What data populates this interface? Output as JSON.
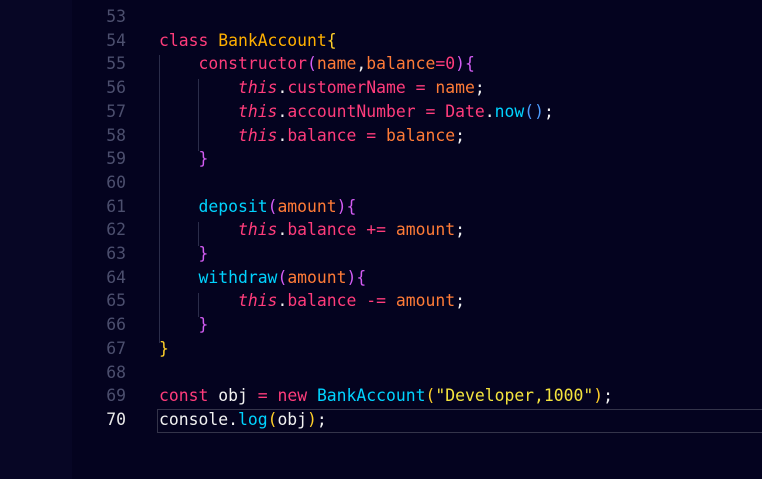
{
  "editor": {
    "line_numbers": [
      "53",
      "54",
      "55",
      "56",
      "57",
      "58",
      "59",
      "60",
      "61",
      "62",
      "63",
      "64",
      "65",
      "66",
      "67",
      "68",
      "69",
      "70"
    ],
    "active_line": "70",
    "lines": [
      [],
      [
        {
          "t": "class",
          "c": "kw"
        },
        {
          "t": " "
        },
        {
          "t": "BankAccount",
          "c": "cls"
        },
        {
          "t": "{",
          "c": "br-y"
        }
      ],
      [
        {
          "t": "    "
        },
        {
          "t": "constructor",
          "c": "kw"
        },
        {
          "t": "(",
          "c": "br-m"
        },
        {
          "t": "name",
          "c": "param"
        },
        {
          "t": ",",
          "c": "pl"
        },
        {
          "t": "balance",
          "c": "param"
        },
        {
          "t": "=",
          "c": "kw"
        },
        {
          "t": "0",
          "c": "num"
        },
        {
          "t": ")",
          "c": "br-m"
        },
        {
          "t": "{",
          "c": "br-m"
        }
      ],
      [
        {
          "t": "        "
        },
        {
          "t": "this",
          "c": "this"
        },
        {
          "t": ".",
          "c": "pl"
        },
        {
          "t": "customerName",
          "c": "prop"
        },
        {
          "t": " "
        },
        {
          "t": "=",
          "c": "kw"
        },
        {
          "t": " "
        },
        {
          "t": "name",
          "c": "param"
        },
        {
          "t": ";",
          "c": "pl"
        }
      ],
      [
        {
          "t": "        "
        },
        {
          "t": "this",
          "c": "this"
        },
        {
          "t": ".",
          "c": "pl"
        },
        {
          "t": "accountNumber",
          "c": "prop"
        },
        {
          "t": " "
        },
        {
          "t": "=",
          "c": "kw"
        },
        {
          "t": " "
        },
        {
          "t": "Date",
          "c": "prop"
        },
        {
          "t": ".",
          "c": "pl"
        },
        {
          "t": "now",
          "c": "fn"
        },
        {
          "t": "()",
          "c": "br-b"
        },
        {
          "t": ";",
          "c": "pl"
        }
      ],
      [
        {
          "t": "        "
        },
        {
          "t": "this",
          "c": "this"
        },
        {
          "t": ".",
          "c": "pl"
        },
        {
          "t": "balance",
          "c": "prop"
        },
        {
          "t": " "
        },
        {
          "t": "=",
          "c": "kw"
        },
        {
          "t": " "
        },
        {
          "t": "balance",
          "c": "param"
        },
        {
          "t": ";",
          "c": "pl"
        }
      ],
      [
        {
          "t": "    "
        },
        {
          "t": "}",
          "c": "br-m"
        }
      ],
      [],
      [
        {
          "t": "    "
        },
        {
          "t": "deposit",
          "c": "fn"
        },
        {
          "t": "(",
          "c": "br-m"
        },
        {
          "t": "amount",
          "c": "param"
        },
        {
          "t": ")",
          "c": "br-m"
        },
        {
          "t": "{",
          "c": "br-m"
        }
      ],
      [
        {
          "t": "        "
        },
        {
          "t": "this",
          "c": "this"
        },
        {
          "t": ".",
          "c": "pl"
        },
        {
          "t": "balance",
          "c": "prop"
        },
        {
          "t": " "
        },
        {
          "t": "+=",
          "c": "kw"
        },
        {
          "t": " "
        },
        {
          "t": "amount",
          "c": "param"
        },
        {
          "t": ";",
          "c": "pl"
        }
      ],
      [
        {
          "t": "    "
        },
        {
          "t": "}",
          "c": "br-m"
        }
      ],
      [
        {
          "t": "    "
        },
        {
          "t": "withdraw",
          "c": "fn"
        },
        {
          "t": "(",
          "c": "br-m"
        },
        {
          "t": "amount",
          "c": "param"
        },
        {
          "t": ")",
          "c": "br-m"
        },
        {
          "t": "{",
          "c": "br-m"
        }
      ],
      [
        {
          "t": "        "
        },
        {
          "t": "this",
          "c": "this"
        },
        {
          "t": ".",
          "c": "pl"
        },
        {
          "t": "balance",
          "c": "prop"
        },
        {
          "t": " "
        },
        {
          "t": "-=",
          "c": "kw"
        },
        {
          "t": " "
        },
        {
          "t": "amount",
          "c": "param"
        },
        {
          "t": ";",
          "c": "pl"
        }
      ],
      [
        {
          "t": "    "
        },
        {
          "t": "}",
          "c": "br-m"
        }
      ],
      [
        {
          "t": "}",
          "c": "br-y"
        }
      ],
      [],
      [
        {
          "t": "const",
          "c": "kw"
        },
        {
          "t": " "
        },
        {
          "t": "obj",
          "c": "pl"
        },
        {
          "t": " "
        },
        {
          "t": "=",
          "c": "kw"
        },
        {
          "t": " "
        },
        {
          "t": "new",
          "c": "kw"
        },
        {
          "t": " "
        },
        {
          "t": "BankAccount",
          "c": "fn"
        },
        {
          "t": "(",
          "c": "br-y"
        },
        {
          "t": "\"Developer,1000\"",
          "c": "str"
        },
        {
          "t": ")",
          "c": "br-y"
        },
        {
          "t": ";",
          "c": "pl"
        }
      ],
      [
        {
          "t": "console",
          "c": "pl"
        },
        {
          "t": ".",
          "c": "pl"
        },
        {
          "t": "log",
          "c": "fn"
        },
        {
          "t": "(",
          "c": "br-y"
        },
        {
          "t": "obj",
          "c": "pl"
        },
        {
          "t": ")",
          "c": "br-y"
        },
        {
          "t": ";",
          "c": "pl"
        }
      ]
    ]
  },
  "colors": {
    "background": "#04031f",
    "keyword": "#ff3c7b",
    "class_name": "#ffb000",
    "function": "#00d3ff",
    "parameter": "#ff7b37",
    "string": "#f4e43e",
    "line_number": "#4c4f6e",
    "line_number_active": "#e8e8e8"
  }
}
